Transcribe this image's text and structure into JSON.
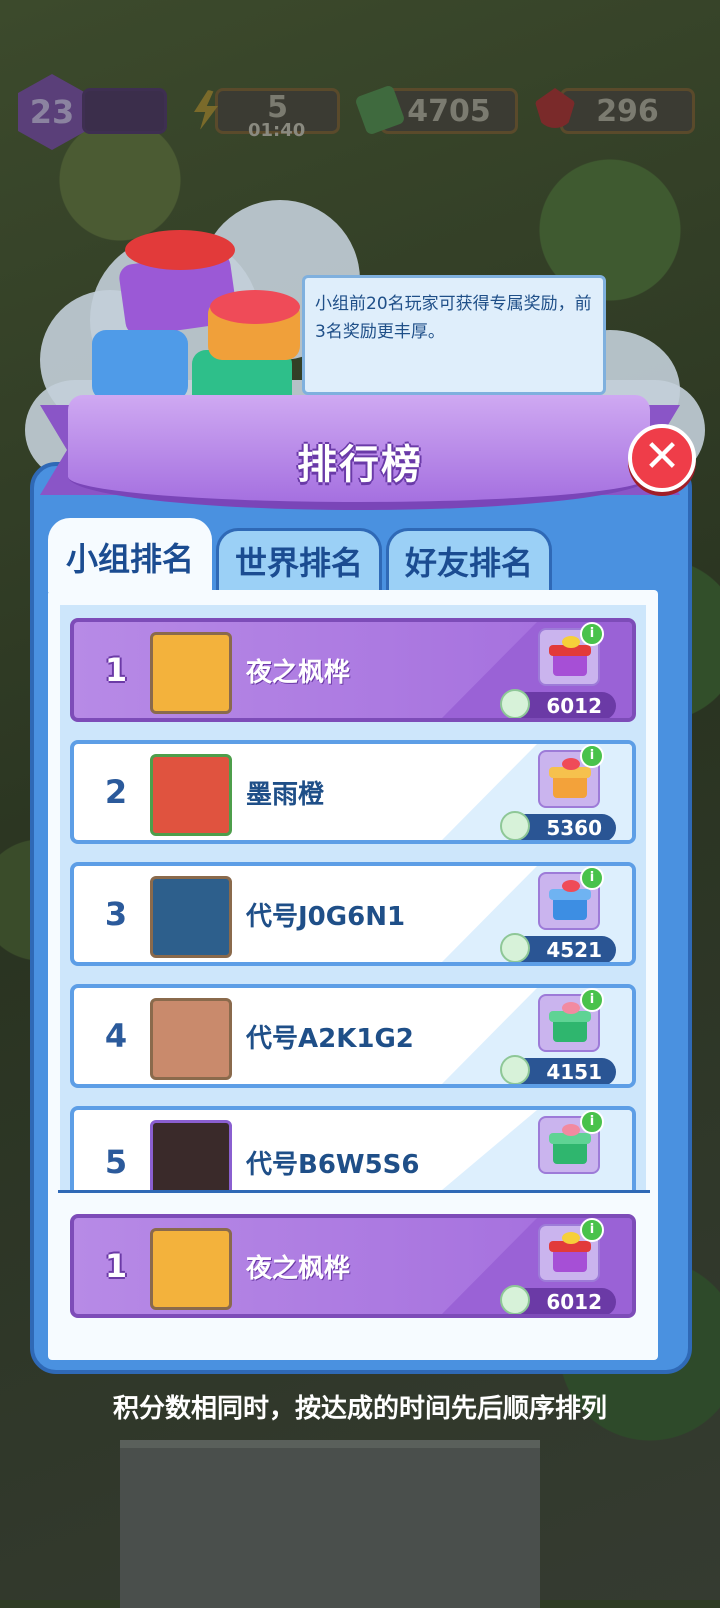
{
  "hud": {
    "level": "23",
    "energy": "5",
    "energy_timer": "01:40",
    "cash": "4705",
    "gems": "296"
  },
  "popup": {
    "title": "排行榜",
    "tooltip": "小组前20名玩家可获得专属奖励，前3名奖励更丰厚。",
    "tabs": [
      "小组排名",
      "世界排名",
      "好友排名"
    ],
    "rows": [
      {
        "rank": "1",
        "name": "夜之枫桦",
        "score": "6012",
        "gift_color": "#a64fd6"
      },
      {
        "rank": "2",
        "name": "墨雨橙",
        "score": "5360",
        "gift_color": "#f3a23a"
      },
      {
        "rank": "3",
        "name": "代号J0G6N1",
        "score": "4521",
        "gift_color": "#3d8ee3"
      },
      {
        "rank": "4",
        "name": "代号A2K1G2",
        "score": "4151",
        "gift_color": "#2fb66e"
      },
      {
        "rank": "5",
        "name": "代号B6W5S6",
        "score": "",
        "gift_color": "#2fb66e"
      }
    ],
    "my_row": {
      "rank": "1",
      "name": "夜之枫桦",
      "score": "6012"
    },
    "footer": "积分数相同时，按达成的时间先后顺序排列"
  },
  "colors": {
    "panel_blue": "#4a91e0",
    "ribbon_purple": "#a570e0",
    "close_red": "#ef3d49",
    "highlight_purple": "#b78ae6"
  }
}
